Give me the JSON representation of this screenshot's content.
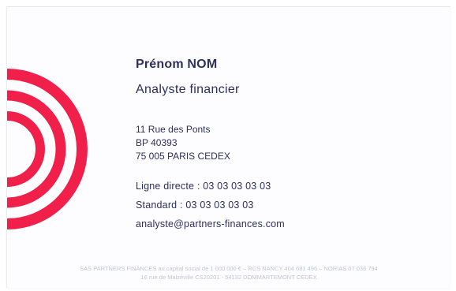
{
  "card": {
    "name": "Prénom NOM",
    "role": "Analyste financier",
    "address": {
      "line1": "11 Rue des Ponts",
      "line2": "BP 40393",
      "line3": "75 005 PARIS CEDEX"
    },
    "contacts": {
      "direct_line": "Ligne directe : 03 03 03 03 03",
      "standard": "Standard : 03 03 03 03 03",
      "email": "analyste@partners-finances.com"
    },
    "legal": {
      "line1": "SAS PARTNERS FINANCES au capital social de 1 000 000 € – RCS NANCY 404 681 496 – NORIAS 07 036 794",
      "line2": "16 rue de Malzéville CS20201 - 54132 DOMMARTEMONT CEDEX"
    }
  },
  "colors": {
    "accent": "#f0204a",
    "text": "#2d2f5c",
    "legal": "#c3c4d6"
  },
  "icons": {
    "logo": "concentric-rings-logo-icon"
  }
}
